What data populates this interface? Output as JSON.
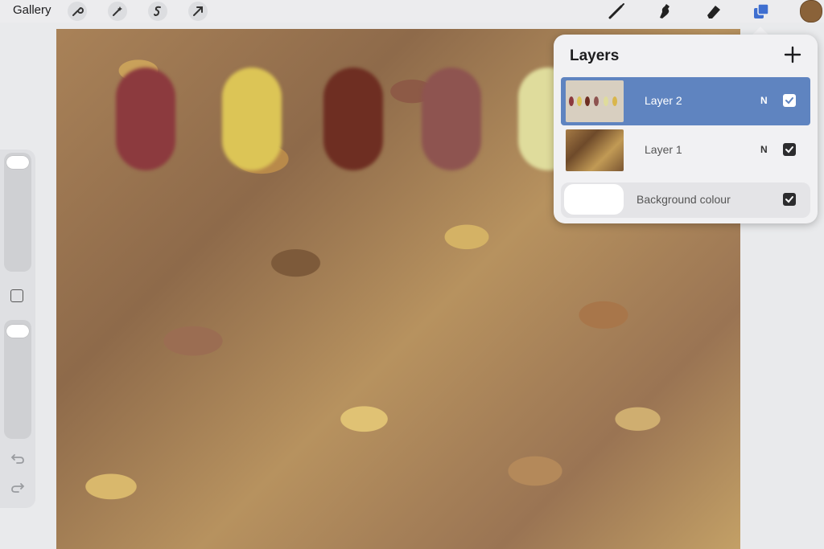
{
  "topbar": {
    "gallery_label": "Gallery",
    "left_tools": [
      "wrench-icon",
      "magic-wand-icon",
      "selection-icon",
      "transform-arrow-icon"
    ],
    "right_tools": [
      "brush-icon",
      "smudge-icon",
      "eraser-icon",
      "layers-icon"
    ],
    "active_tool": "layers-icon",
    "current_color": "#8a6239"
  },
  "canvas": {
    "color_swatches": [
      "#8c3a3e",
      "#dcc556",
      "#6e2e22",
      "#8e5450",
      "#dfdc9c"
    ]
  },
  "sidebar": {
    "icons": [
      "brush-size-slider",
      "modify-square-icon",
      "opacity-slider",
      "undo-icon",
      "redo-icon"
    ]
  },
  "layers": {
    "title": "Layers",
    "add_icon": "plus-icon",
    "items": [
      {
        "name": "Layer 2",
        "blend": "N",
        "visible": true,
        "selected": true
      },
      {
        "name": "Layer 1",
        "blend": "N",
        "visible": true,
        "selected": false
      }
    ],
    "background": {
      "label": "Background colour",
      "visible": true,
      "color": "#ffffff"
    }
  },
  "colors": {
    "accent": "#5f84c0",
    "layers_icon": "#3f6fd0"
  }
}
